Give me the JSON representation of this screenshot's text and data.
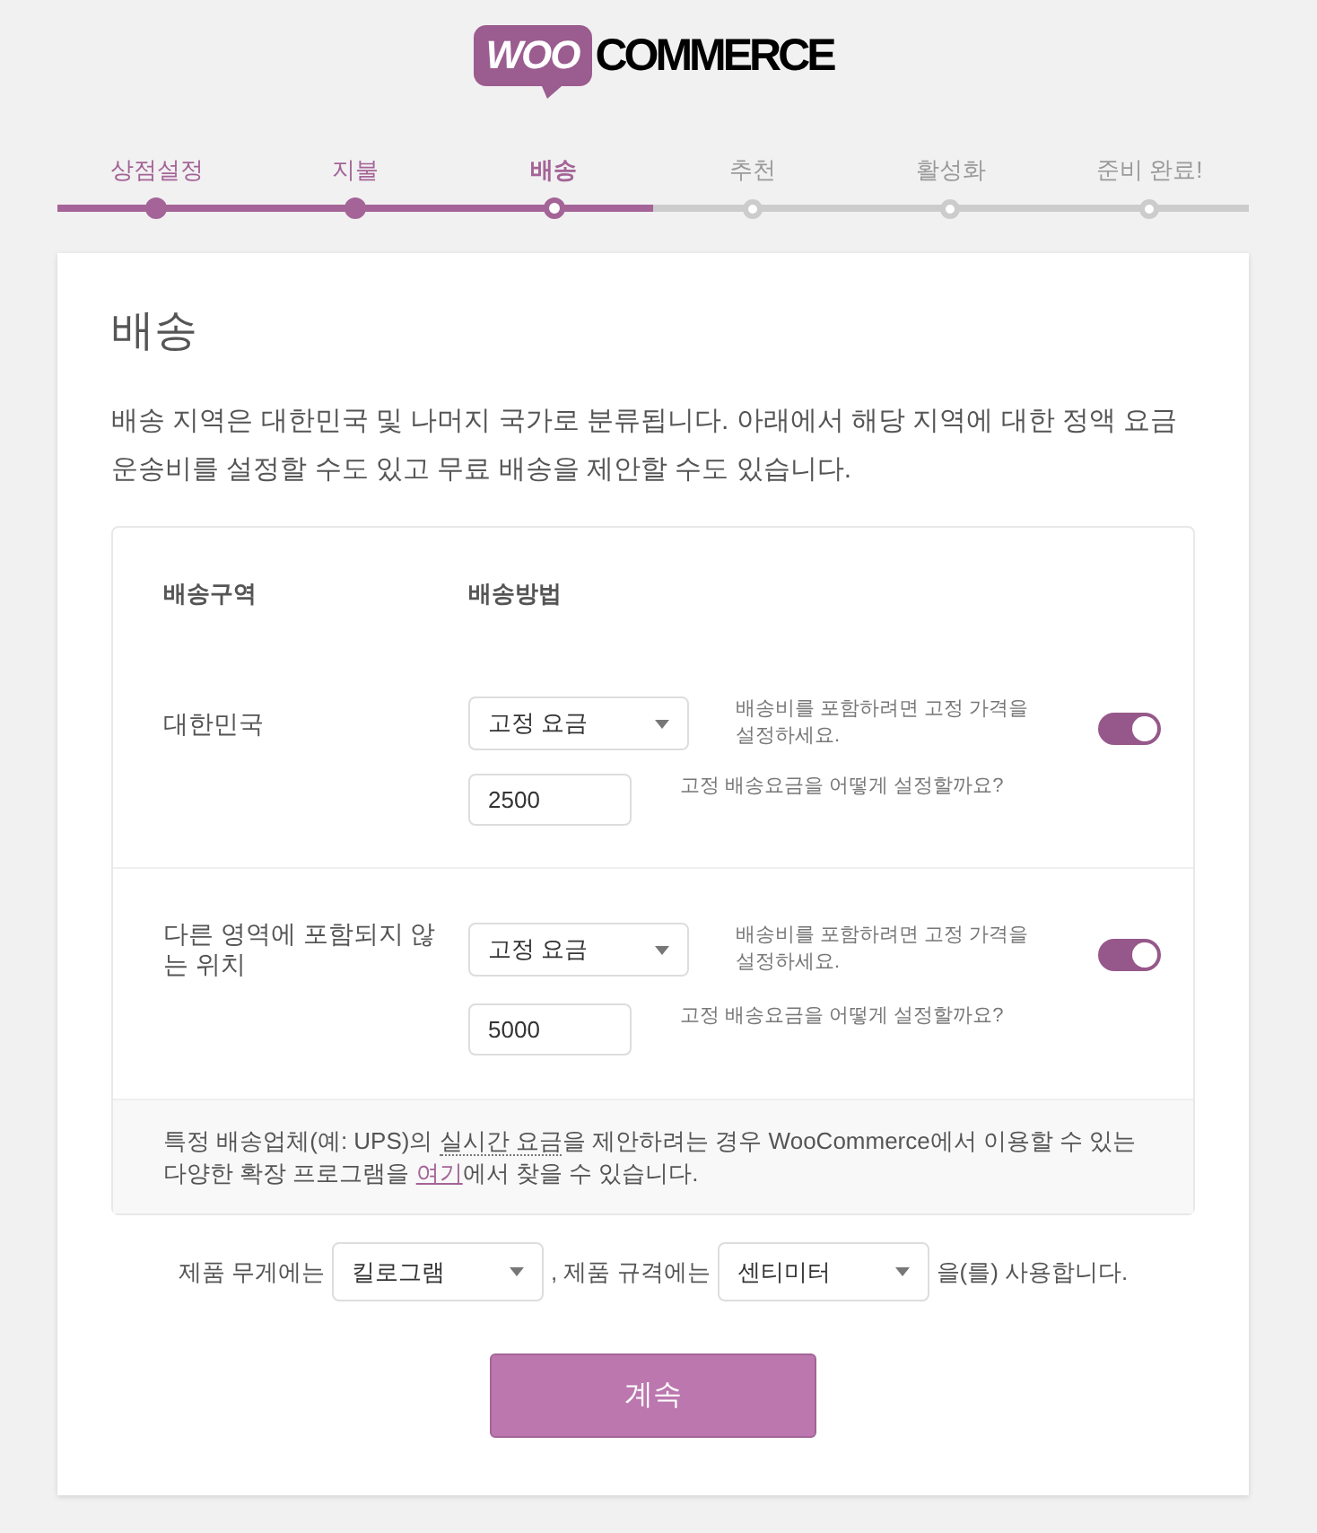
{
  "logo": {
    "badge": "WOO",
    "wordmark": "COMMERCE"
  },
  "steps": [
    {
      "label": "상점설정",
      "completed": true,
      "selected": false
    },
    {
      "label": "지불",
      "completed": true,
      "selected": false
    },
    {
      "label": "배송",
      "completed": false,
      "selected": true
    },
    {
      "label": "추천",
      "completed": false,
      "selected": false
    },
    {
      "label": "활성화",
      "completed": false,
      "selected": false
    },
    {
      "label": "준비 완료!",
      "completed": false,
      "selected": false
    }
  ],
  "page": {
    "title": "배송",
    "description": "배송 지역은 대한민국 및 나머지 국가로 분류됩니다. 아래에서 해당 지역에 대한 정액 요금 운송비를 설정할 수도 있고 무료 배송을 제안할 수도 있습니다."
  },
  "zones_table": {
    "columns": [
      "배송구역",
      "배송방법"
    ],
    "rows": [
      {
        "zone": "대한민국",
        "method": "고정 요금",
        "method_hint": "배송비를 포함하려면 고정 가격을 설정하세요.",
        "rate": "2500",
        "rate_hint": "고정 배송요금을 어떻게 설정할까요?",
        "on": true
      },
      {
        "zone": "다른 영역에 포함되지 않는 위치",
        "method": "고정 요금",
        "method_hint": "배송비를 포함하려면 고정 가격을 설정하세요.",
        "rate": "5000",
        "rate_hint": "고정 배송요금을 어떻게 설정할까요?",
        "on": true
      }
    ],
    "note": {
      "before": "특정 배송업체(예: UPS)의 ",
      "abbr": "실시간 요금",
      "middle": "을 제안하려는 경우 WooCommerce에서 이용할 수 있는 다양한 확장 프로그램을 ",
      "link": "여기",
      "after": "에서 찾을 수 있습니다."
    }
  },
  "units": {
    "weight_label": "제품 무게에는",
    "weight": "킬로그램",
    "dimension_label": ", 제품 규격에는",
    "dimension": "센티미터",
    "suffix": "을(를) 사용합니다."
  },
  "continue_button": "계속"
}
